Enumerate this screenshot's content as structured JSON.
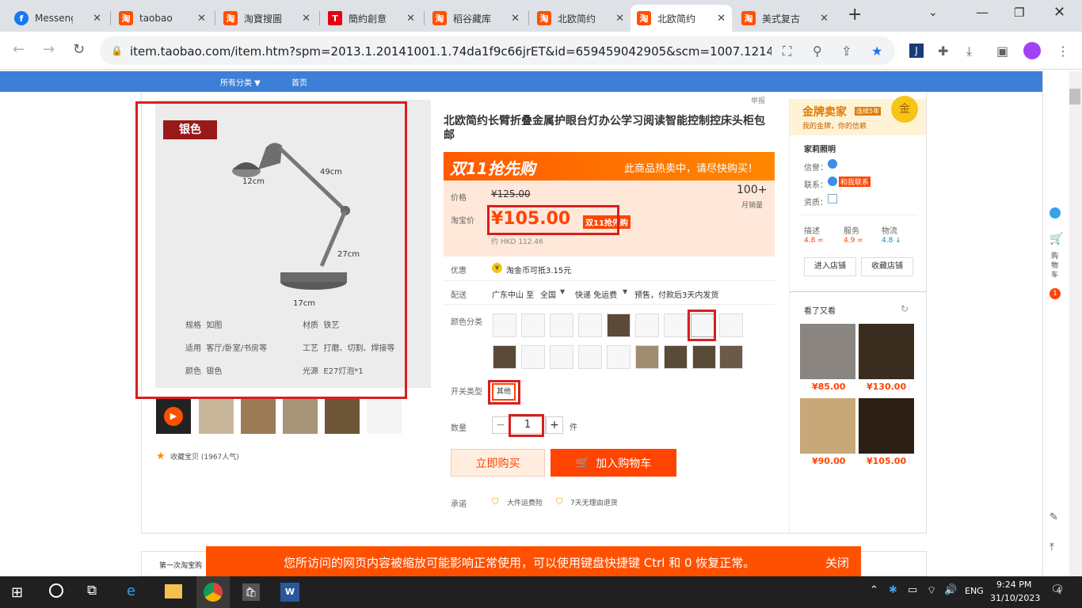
{
  "tabs": [
    {
      "title": "Messeng",
      "icon": "facebook-icon"
    },
    {
      "title": "taobao",
      "icon": "taobao-icon"
    },
    {
      "title": "淘寶搜圖",
      "icon": "taobao-icon"
    },
    {
      "title": "簡約創意",
      "icon": "t-icon"
    },
    {
      "title": "稻谷藏库",
      "icon": "taobao-icon"
    },
    {
      "title": "北欧简约",
      "icon": "taobao-icon"
    },
    {
      "title": "北欧简约",
      "icon": "taobao-icon",
      "active": true
    },
    {
      "title": "美式复古",
      "icon": "taobao-icon"
    }
  ],
  "url": "item.taobao.com/item.htm?spm=2013.1.20141001.1.74da1f9c66jrET&id=659459042905&scm=1007.12144.9...",
  "nav": {
    "category": "所有分类 ▼",
    "home": "首页"
  },
  "product": {
    "report": "举报",
    "title": "北欧简约长臂折叠金属护眼台灯办公学习阅读智能控制控床头柜包邮",
    "promo_banner": "双11抢先购",
    "promo_hot": "此商品热卖中，请尽快购买！",
    "price_label": "价格",
    "price_original": "¥125.00",
    "monthly_sales": "100+",
    "monthly_sales_label": "月销量",
    "taobao_price_label": "淘宝价",
    "taobao_price": "¥105.00",
    "price_tag": "双11抢先购",
    "hkd": "约 HKD 112.46",
    "discount_label": "优惠",
    "discount_text": "淘金币可抵3.15元",
    "delivery_label": "配送",
    "delivery_from": "广东中山 至",
    "delivery_to": "全国",
    "delivery_fee": "快递 免运费",
    "delivery_note": "预售，付款后3天内发货",
    "color_label": "颜色分类",
    "switch_label": "开关类型",
    "switch_option": "其他",
    "qty_label": "数量",
    "qty_value": "1",
    "qty_unit": "件",
    "qty_minus": "−",
    "qty_plus": "+",
    "buy_now": "立即购买",
    "add_cart": "加入购物车",
    "promise_label": "承诺",
    "promise_1": "大件运费险",
    "promise_2": "7天无理由退货",
    "favorite": "收藏宝贝 (1967人气)"
  },
  "main_image": {
    "color_tag": "银色",
    "dim_width": "12cm",
    "dim_arm1": "49cm",
    "dim_arm2": "27cm",
    "dim_base": "17cm",
    "specs": [
      {
        "k1": "规格",
        "v1": "如图",
        "k2": "材质",
        "v2": "铁艺"
      },
      {
        "k1": "适用",
        "v1": "客厅/卧室/书房等",
        "k2": "工艺",
        "v2": "打磨、切割、焊接等"
      },
      {
        "k1": "颜色",
        "v1": "银色",
        "k2": "光源",
        "v2": "E27灯泡*1"
      }
    ]
  },
  "seller": {
    "badge": "金牌卖家",
    "badge_sub": "我的金牌，你的信赖",
    "badge_level": "连续5年",
    "medal": "金",
    "shop_name": "家莉照明",
    "credit_label": "信誉：",
    "contact_label": "联系：",
    "contact_btn": "和我联系",
    "qual_label": "资质：",
    "ratings": [
      {
        "label": "描述",
        "value": "4.8 ="
      },
      {
        "label": "服务",
        "value": "4.9 ="
      },
      {
        "label": "物流",
        "value": "4.8 ↓"
      }
    ],
    "enter_shop": "进入店铺",
    "fav_shop": "收藏店铺",
    "also_viewed": "看了又看",
    "recs": [
      {
        "price": "¥85.00"
      },
      {
        "price": "¥130.00"
      },
      {
        "price": "¥90.00"
      },
      {
        "price": "¥105.00"
      }
    ]
  },
  "rightbar": {
    "cart_label": "购物车",
    "cart_count": "1"
  },
  "notice": {
    "text": "您所访问的网页内容被缩放可能影响正常使用，可以使用键盘快捷键 Ctrl 和 0 恢复正常。",
    "close": "关闭"
  },
  "first_tab_text": "第一次淘宝购",
  "taskbar": {
    "lang": "ENG",
    "time": "9:24 PM",
    "date": "31/10/2023",
    "notif": "4"
  }
}
